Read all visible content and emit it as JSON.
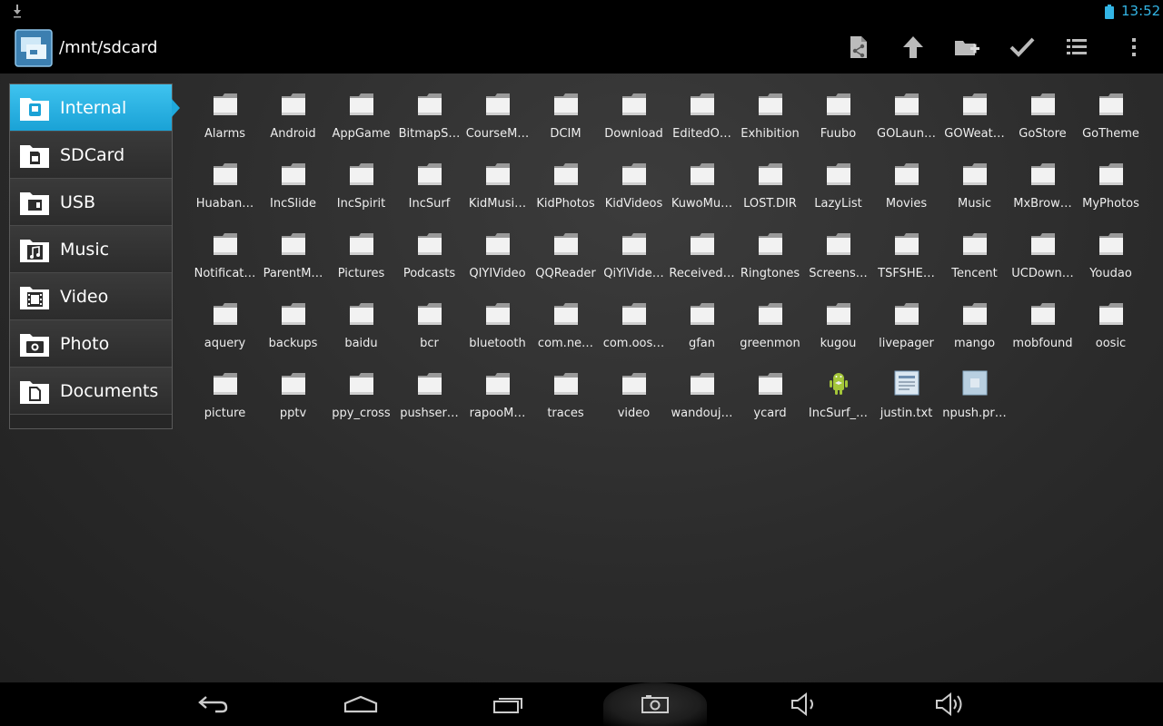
{
  "status": {
    "time": "13:52",
    "colors": {
      "accent": "#33b5e5"
    }
  },
  "header": {
    "path": "/mnt/sdcard"
  },
  "toolbar": {
    "icons": [
      "share-icon",
      "up-arrow-icon",
      "new-folder-icon",
      "check-icon",
      "list-view-icon",
      "overflow-menu-icon"
    ]
  },
  "sidebar": {
    "items": [
      {
        "label": "Internal",
        "icon": "phone-icon",
        "active": true
      },
      {
        "label": "SDCard",
        "icon": "sdcard-icon"
      },
      {
        "label": "USB",
        "icon": "usb-icon"
      },
      {
        "label": "Music",
        "icon": "music-icon"
      },
      {
        "label": "Video",
        "icon": "video-icon"
      },
      {
        "label": "Photo",
        "icon": "camera-icon"
      },
      {
        "label": "Documents",
        "icon": "document-icon"
      }
    ]
  },
  "files": [
    {
      "name": "Alarms",
      "type": "folder"
    },
    {
      "name": "Android",
      "type": "folder"
    },
    {
      "name": "AppGame",
      "type": "folder"
    },
    {
      "name": "BitmapS…",
      "type": "folder"
    },
    {
      "name": "CourseM…",
      "type": "folder"
    },
    {
      "name": "DCIM",
      "type": "folder"
    },
    {
      "name": "Download",
      "type": "folder"
    },
    {
      "name": "EditedO…",
      "type": "folder"
    },
    {
      "name": "Exhibition",
      "type": "folder"
    },
    {
      "name": "Fuubo",
      "type": "folder"
    },
    {
      "name": "GOLaun…",
      "type": "folder"
    },
    {
      "name": "GOWeat…",
      "type": "folder"
    },
    {
      "name": "GoStore",
      "type": "folder"
    },
    {
      "name": "GoTheme",
      "type": "folder"
    },
    {
      "name": "Huaban…",
      "type": "folder"
    },
    {
      "name": "IncSlide",
      "type": "folder"
    },
    {
      "name": "IncSpirit",
      "type": "folder"
    },
    {
      "name": "IncSurf",
      "type": "folder"
    },
    {
      "name": "KidMusi…",
      "type": "folder"
    },
    {
      "name": "KidPhotos",
      "type": "folder"
    },
    {
      "name": "KidVideos",
      "type": "folder"
    },
    {
      "name": "KuwoMu…",
      "type": "folder"
    },
    {
      "name": "LOST.DIR",
      "type": "folder"
    },
    {
      "name": "LazyList",
      "type": "folder"
    },
    {
      "name": "Movies",
      "type": "folder"
    },
    {
      "name": "Music",
      "type": "folder"
    },
    {
      "name": "MxBrow…",
      "type": "folder"
    },
    {
      "name": "MyPhotos",
      "type": "folder"
    },
    {
      "name": "Notificat…",
      "type": "folder"
    },
    {
      "name": "ParentM…",
      "type": "folder"
    },
    {
      "name": "Pictures",
      "type": "folder"
    },
    {
      "name": "Podcasts",
      "type": "folder"
    },
    {
      "name": "QIYIVideo",
      "type": "folder"
    },
    {
      "name": "QQReader",
      "type": "folder"
    },
    {
      "name": "QiYiVide…",
      "type": "folder"
    },
    {
      "name": "Received…",
      "type": "folder"
    },
    {
      "name": "Ringtones",
      "type": "folder"
    },
    {
      "name": "Screens…",
      "type": "folder"
    },
    {
      "name": "TSFSHE…",
      "type": "folder"
    },
    {
      "name": "Tencent",
      "type": "folder"
    },
    {
      "name": "UCDown…",
      "type": "folder"
    },
    {
      "name": "Youdao",
      "type": "folder"
    },
    {
      "name": "aquery",
      "type": "folder"
    },
    {
      "name": "backups",
      "type": "folder"
    },
    {
      "name": "baidu",
      "type": "folder"
    },
    {
      "name": "bcr",
      "type": "folder"
    },
    {
      "name": "bluetooth",
      "type": "folder"
    },
    {
      "name": "com.ne…",
      "type": "folder"
    },
    {
      "name": "com.oos…",
      "type": "folder"
    },
    {
      "name": "gfan",
      "type": "folder"
    },
    {
      "name": "greenmon",
      "type": "folder"
    },
    {
      "name": "kugou",
      "type": "folder"
    },
    {
      "name": "livepager",
      "type": "folder"
    },
    {
      "name": "mango",
      "type": "folder"
    },
    {
      "name": "mobfound",
      "type": "folder"
    },
    {
      "name": "oosic",
      "type": "folder"
    },
    {
      "name": "picture",
      "type": "folder"
    },
    {
      "name": "pptv",
      "type": "folder"
    },
    {
      "name": "ppy_cross",
      "type": "folder"
    },
    {
      "name": "pushser…",
      "type": "folder"
    },
    {
      "name": "rapooM…",
      "type": "folder"
    },
    {
      "name": "traces",
      "type": "folder"
    },
    {
      "name": "video",
      "type": "folder"
    },
    {
      "name": "wandouj…",
      "type": "folder"
    },
    {
      "name": "ycard",
      "type": "folder"
    },
    {
      "name": "IncSurf_…",
      "type": "apk"
    },
    {
      "name": "justin.txt",
      "type": "text"
    },
    {
      "name": "npush.pr…",
      "type": "unknown"
    }
  ],
  "navbar": {
    "icons": [
      "back-icon",
      "home-icon",
      "recent-apps-icon",
      "screenshot-icon",
      "volume-down-icon",
      "volume-up-icon"
    ]
  }
}
